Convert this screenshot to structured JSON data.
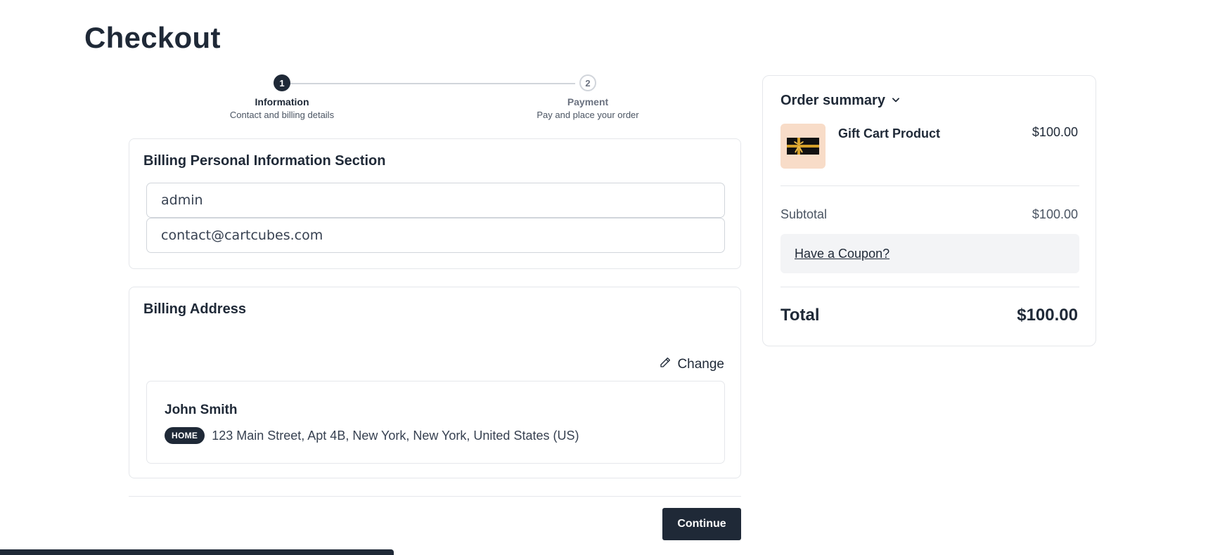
{
  "page": {
    "title": "Checkout"
  },
  "stepper": {
    "steps": [
      {
        "number": "1",
        "title": "Information",
        "description": "Contact and billing details"
      },
      {
        "number": "2",
        "title": "Payment",
        "description": "Pay and place your order"
      }
    ]
  },
  "personal_info": {
    "title": "Billing Personal Information Section",
    "name_value": "admin",
    "email_value": "contact@cartcubes.com"
  },
  "billing_address": {
    "title": "Billing Address",
    "change_label": "Change",
    "name": "John Smith",
    "badge": "HOME",
    "address": "123 Main Street, Apt 4B, New York, New York, United States (US)"
  },
  "actions": {
    "continue_label": "Continue"
  },
  "order_summary": {
    "title": "Order summary",
    "product": {
      "name": "Gift Cart Product",
      "price": "$100.00",
      "image_icon": "gift-card-icon"
    },
    "subtotal_label": "Subtotal",
    "subtotal_value": "$100.00",
    "coupon_label": "Have a Coupon?",
    "total_label": "Total",
    "total_value": "$100.00"
  },
  "colors": {
    "primary": "#1f2937",
    "border": "#e5e7eb",
    "product_bg": "#f8dcc8",
    "coupon_bg": "#f3f4f6"
  }
}
